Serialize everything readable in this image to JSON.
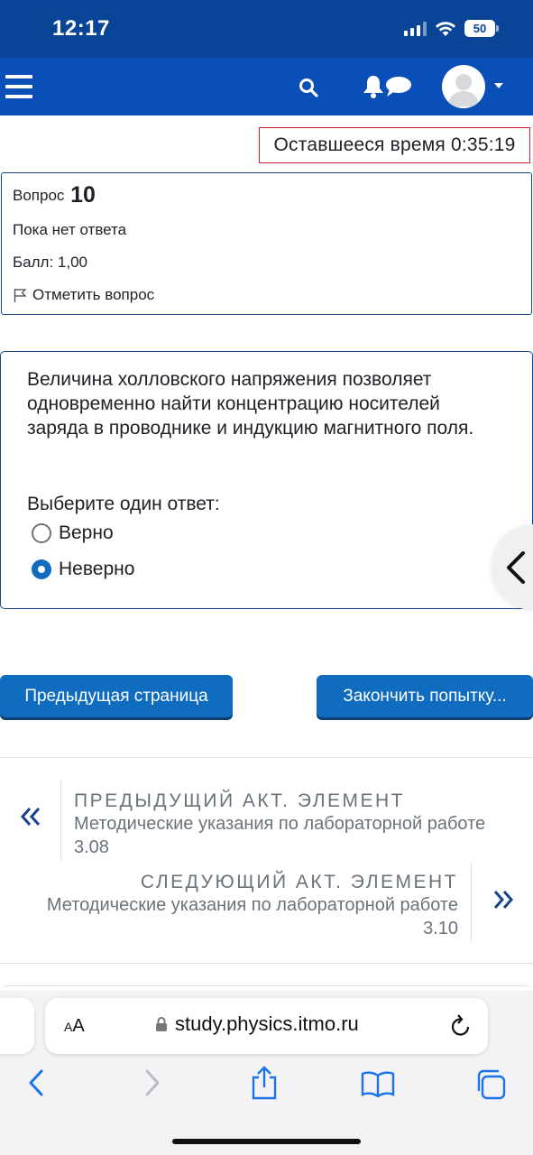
{
  "status_bar": {
    "time": "12:17",
    "battery": "50"
  },
  "timer": {
    "text": "Оставшееся время 0:35:19"
  },
  "question_info": {
    "label": "Вопрос",
    "number": "10",
    "state": "Пока нет ответа",
    "grade": "Балл: 1,00",
    "flag_label": "Отметить вопрос"
  },
  "question": {
    "text": "Величина холловского напряжения позволяет одновременно найти концентрацию носителей заряда в проводнике и индукцию магнитного поля.",
    "prompt": "Выберите один ответ:",
    "options": [
      {
        "label": "Верно",
        "selected": false
      },
      {
        "label": "Неверно",
        "selected": true
      }
    ]
  },
  "buttons": {
    "prev_page": "Предыдущая страница",
    "finish": "Закончить попытку..."
  },
  "activity_nav": {
    "prev_label": "ПРЕДЫДУЩИЙ АКТ. ЭЛЕМЕНТ",
    "prev_title": "Методические указания по лабораторной работе 3.08",
    "prev_arrow": "«",
    "next_label": "СЛЕДУЮЩИЙ АКТ. ЭЛЕМЕНТ",
    "next_title": "Методические указания по лабораторной работе 3.10",
    "next_arrow": "»"
  },
  "browser": {
    "aa_label_small": "A",
    "aa_label_big": "A",
    "url": "study.physics.itmo.ru"
  },
  "colors": {
    "navbar": "#0a4fb8",
    "status_bar": "#0a4496",
    "primary_button": "#0f6cbf",
    "timer_border": "#c8202b",
    "box_border": "#17438a"
  }
}
